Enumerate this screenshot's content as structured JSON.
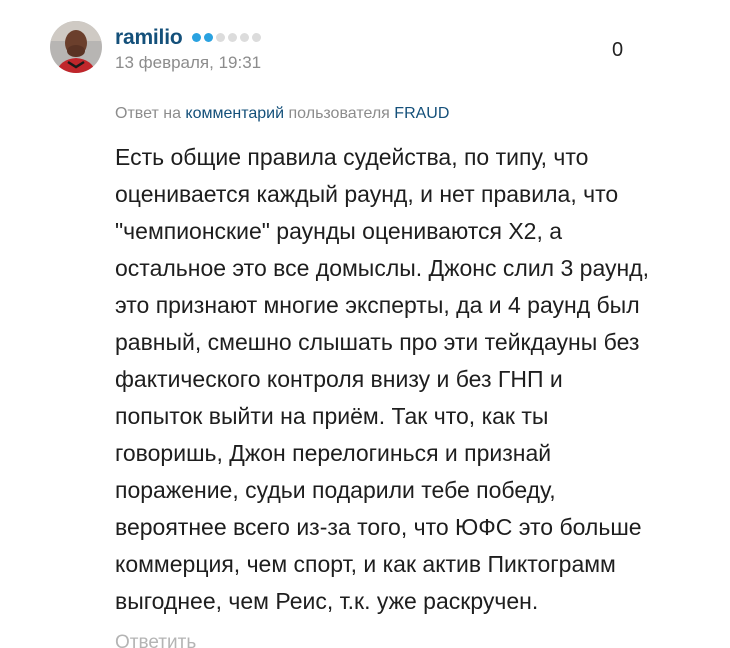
{
  "user": {
    "name": "ramilio",
    "rating_dots_total": 6,
    "rating_dots_filled": 2,
    "rating_color": "#2aa2e0"
  },
  "date": "13 февраля, 19:31",
  "votes": "0",
  "reply_to": {
    "prefix": "Ответ на",
    "link": "комментарий",
    "middle": "пользователя",
    "user": "FRAUD"
  },
  "body_lines": [
    "Есть общие правила судейства, по типу, что",
    "оценивается каждый раунд, и нет правила, что",
    "\"чемпионские\" раунды оцениваются Х2, а",
    "остальное это все домыслы. Джонс слил 3 раунд,",
    "это признают многие эксперты, да и 4 раунд был",
    "равный, смешно слышать про эти тейкдауны без",
    "фактического контроля внизу и без ГНП и",
    "попыток выйти на приём. Так что, как ты",
    "говоришь, Джон перелогинься и признай",
    "поражение, судьи подарили тебе победу,",
    "вероятнее всего из-за того, что ЮФС это больше",
    "коммерция, чем спорт, и как актив Пиктограмм",
    "выгоднее, чем Реис, т.к. уже раскручен."
  ],
  "reply_button": "Ответить",
  "colors": {
    "username": "#14507a",
    "meta": "#8c8c8c",
    "text": "#1e1e1e"
  }
}
